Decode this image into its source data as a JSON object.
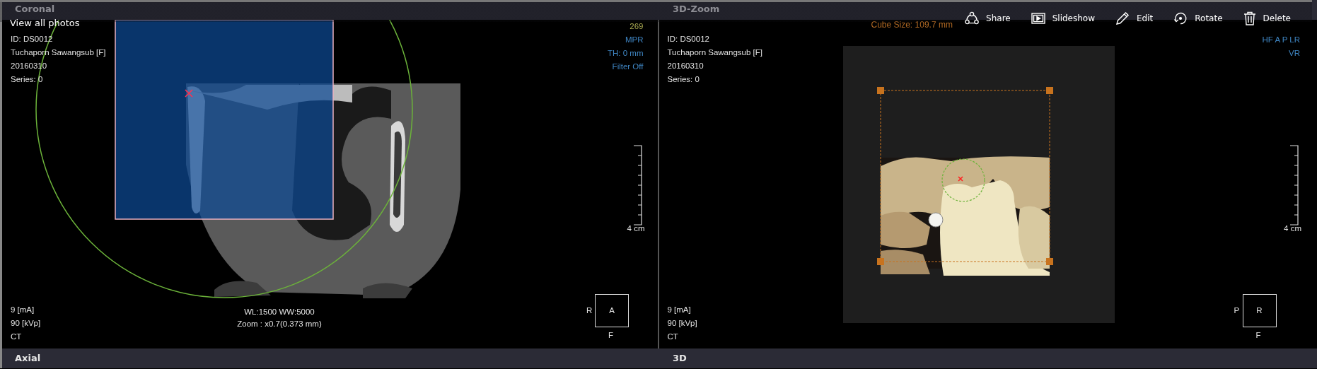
{
  "viewer": {
    "back_link": "View all photos",
    "actions": [
      {
        "kind": "share",
        "label": "Share"
      },
      {
        "kind": "slideshow",
        "label": "Slideshow"
      },
      {
        "kind": "edit",
        "label": "Edit"
      },
      {
        "kind": "rotate",
        "label": "Rotate"
      },
      {
        "kind": "delete",
        "label": "Delete"
      }
    ]
  },
  "app": {
    "top_headers": [
      "Coronal",
      "3D-Zoom"
    ],
    "panels": [
      {
        "kind": "mpr",
        "info": [
          "ID: DS0012",
          "Tuchaporn Sawangsub [F]",
          "20160310",
          "Series: 0"
        ],
        "top_right": [
          {
            "text": "269",
            "color": "#a8a850"
          },
          {
            "text": "MPR",
            "color": "#3f86c4"
          },
          {
            "text": "TH: 0 mm",
            "color": "#3f86c4"
          },
          {
            "text": "Filter Off",
            "color": "#3f86c4"
          }
        ],
        "scale_label": "4 cm",
        "exposure": [
          "9 [mA]",
          "90 [kVp]",
          "CT"
        ],
        "window_level": [
          "WL:1500 WW:5000",
          "Zoom : x0.7(0.373 mm)"
        ],
        "orientation": {
          "center": "A",
          "left": "R",
          "bottom": "F"
        }
      },
      {
        "kind": "volume",
        "cube_size": "Cube Size: 109.7 mm",
        "info": [
          "ID: DS0012",
          "Tuchaporn Sawangsub [F]",
          "20160310",
          "Series: 0"
        ],
        "top_right": [
          {
            "text": "HF A P LR",
            "color": "#3f86c4"
          },
          {
            "text": "VR",
            "color": "#3f86c4"
          }
        ],
        "scale_label": "4 cm",
        "exposure": [
          "9 [mA]",
          "90 [kVp]",
          "CT"
        ],
        "orientation": {
          "center": "R",
          "left": "P",
          "bottom": "F"
        }
      }
    ],
    "bottom_headers": [
      "Axial",
      "3D"
    ]
  }
}
